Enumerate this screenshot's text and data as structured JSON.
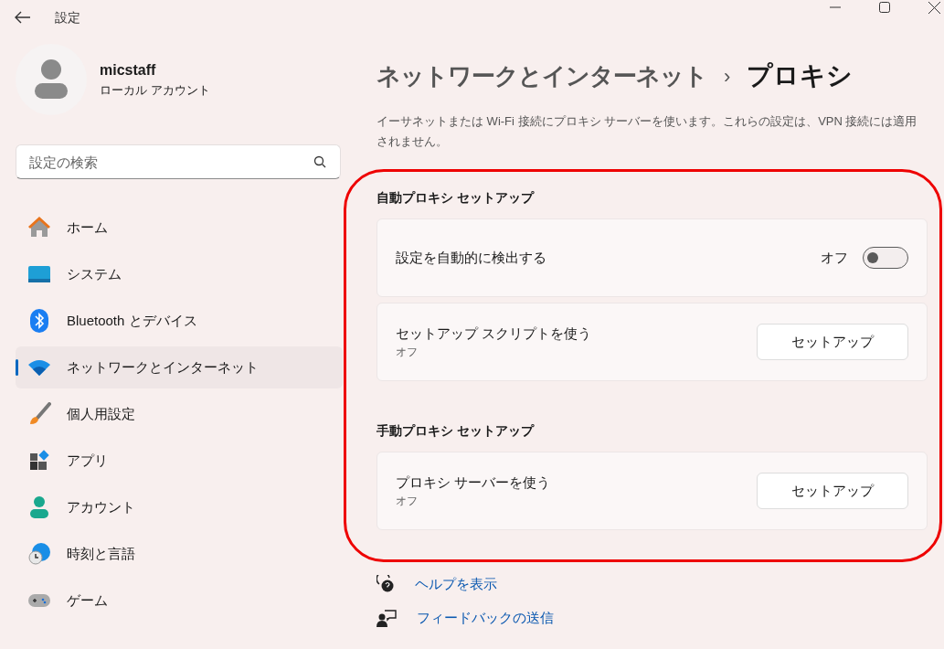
{
  "window": {
    "title": "設定"
  },
  "profile": {
    "name": "micstaff",
    "account_type": "ローカル アカウント"
  },
  "search": {
    "placeholder": "設定の検索"
  },
  "sidebar": {
    "items": [
      {
        "label": "ホーム",
        "selected": false
      },
      {
        "label": "システム",
        "selected": false
      },
      {
        "label": "Bluetooth とデバイス",
        "selected": false
      },
      {
        "label": "ネットワークとインターネット",
        "selected": true
      },
      {
        "label": "個人用設定",
        "selected": false
      },
      {
        "label": "アプリ",
        "selected": false
      },
      {
        "label": "アカウント",
        "selected": false
      },
      {
        "label": "時刻と言語",
        "selected": false
      },
      {
        "label": "ゲーム",
        "selected": false
      }
    ]
  },
  "breadcrumb": {
    "parent": "ネットワークとインターネット",
    "separator": "›",
    "current": "プロキシ"
  },
  "description": "イーサネットまたは Wi-Fi 接続にプロキシ サーバーを使います。これらの設定は、VPN 接続には適用されません。",
  "sections": [
    {
      "title": "自動プロキシ セットアップ",
      "cards": [
        {
          "kind": "toggle",
          "label": "設定を自動的に検出する",
          "state_label": "オフ",
          "on": false
        },
        {
          "kind": "button",
          "label": "セットアップ スクリプトを使う",
          "subtitle": "オフ",
          "button": "セットアップ"
        }
      ]
    },
    {
      "title": "手動プロキシ セットアップ",
      "cards": [
        {
          "kind": "button",
          "label": "プロキシ サーバーを使う",
          "subtitle": "オフ",
          "button": "セットアップ"
        }
      ]
    }
  ],
  "links": [
    "ヘルプを表示",
    "フィードバックの送信"
  ]
}
